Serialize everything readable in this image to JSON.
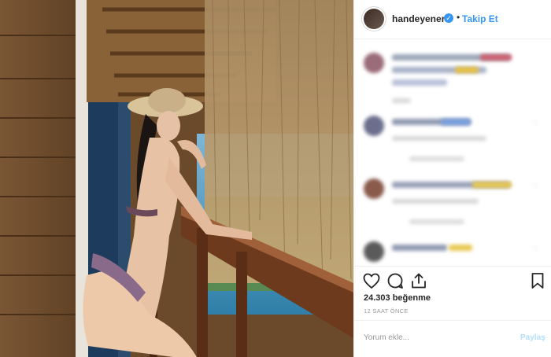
{
  "post": {
    "username": "handeyener",
    "verified_mark": "✓",
    "separator": "•",
    "follow_label": "Takip Et",
    "more_icon": "more-options-icon",
    "likes_text": "24.303 beğenme",
    "time_text": "12 SAAT ÖNCE",
    "comment_placeholder": "Yorum ekle...",
    "post_label": "Paylaş"
  },
  "colors": {
    "accent": "#3897f0",
    "text": "#262626",
    "muted": "#999999",
    "post_disabled": "#b2dffc",
    "border": "#efefef"
  },
  "comments": [
    {
      "avatar_color": "#9a6b78"
    },
    {
      "avatar_color": "#6b6f8c"
    },
    {
      "avatar_color": "#8a5a4a"
    },
    {
      "avatar_color": "#5a5a5a"
    }
  ],
  "icons": [
    "heart-icon",
    "comment-icon",
    "share-icon",
    "bookmark-icon"
  ]
}
